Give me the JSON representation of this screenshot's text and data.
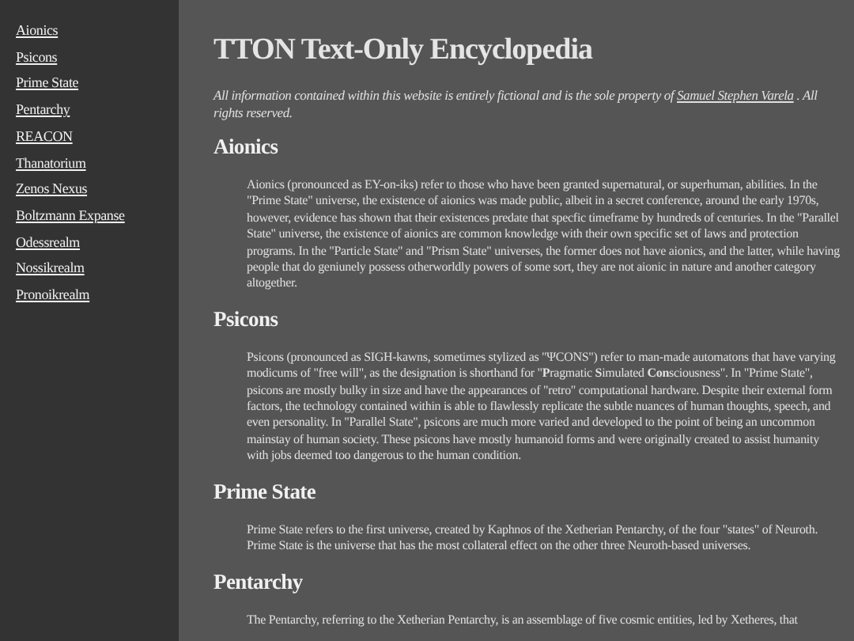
{
  "sidebar": {
    "items": [
      {
        "label": "Aionics"
      },
      {
        "label": "Psicons"
      },
      {
        "label": "Prime State"
      },
      {
        "label": "Pentarchy"
      },
      {
        "label": "REACON"
      },
      {
        "label": "Thanatorium"
      },
      {
        "label": "Zenos Nexus"
      },
      {
        "label": "Boltzmann Expanse"
      },
      {
        "label": "Odessrealm"
      },
      {
        "label": "Nossikrealm"
      },
      {
        "label": "Pronoikrealm"
      }
    ]
  },
  "title": "TTON Text-Only Encyclopedia",
  "notice": {
    "before": "All information contained within this website is entirely fictional and is the sole property of",
    "link": "Samuel Stephen Varela",
    "after": ". All rights reserved."
  },
  "sections": [
    {
      "heading": "Aionics",
      "body": "Aionics (pronounced as EY-on-iks) refer to those who have been granted supernatural, or superhuman, abilities. In the \"Prime State\" universe, the existence of aionics was made public, albeit in a secret conference, around the early 1970s, however, evidence has shown that their existences predate that specfic timeframe by hundreds of centuries. In the \"Parallel State\" universe, the existence of aionics are common knowledge with their own specific set of laws and protection programs. In the \"Particle State\" and \"Prism State\" universes, the former does not have aionics, and the latter, while having people that do geniunely possess otherworldly powers of some sort, they are not aionic in nature and another category altogether."
    },
    {
      "heading": "Psicons",
      "body": "Psicons (pronounced as SIGH-kawns, sometimes stylized as \"ΨCONS\") refer to man-made automatons that have varying modicums of \"free will\", as the designation is shorthand for \"**P**ragmatic **S**imulated **Con**sciousness\". In \"Prime State\", psicons are mostly bulky in size and have the appearances of \"retro\" computational hardware. Despite their external form factors, the technology contained within is able to flawlessly replicate the subtle nuances of human thoughts, speech, and even personality. In \"Parallel State\", psicons are much more varied and developed to the point of being an uncommon mainstay of human society. These psicons have mostly humanoid forms and were originally created to assist humanity with jobs deemed too dangerous to the human condition."
    },
    {
      "heading": "Prime State",
      "body": "Prime State refers to the first universe, created by Kaphnos of the Xetherian Pentarchy, of the four \"states\" of Neuroth. Prime State is the universe that has the most collateral effect on the other three Neuroth-based universes."
    },
    {
      "heading": "Pentarchy",
      "body": "The Pentarchy, referring to the Xetherian Pentarchy, is an assemblage of five cosmic entities, led by Xetheres, that"
    }
  ]
}
